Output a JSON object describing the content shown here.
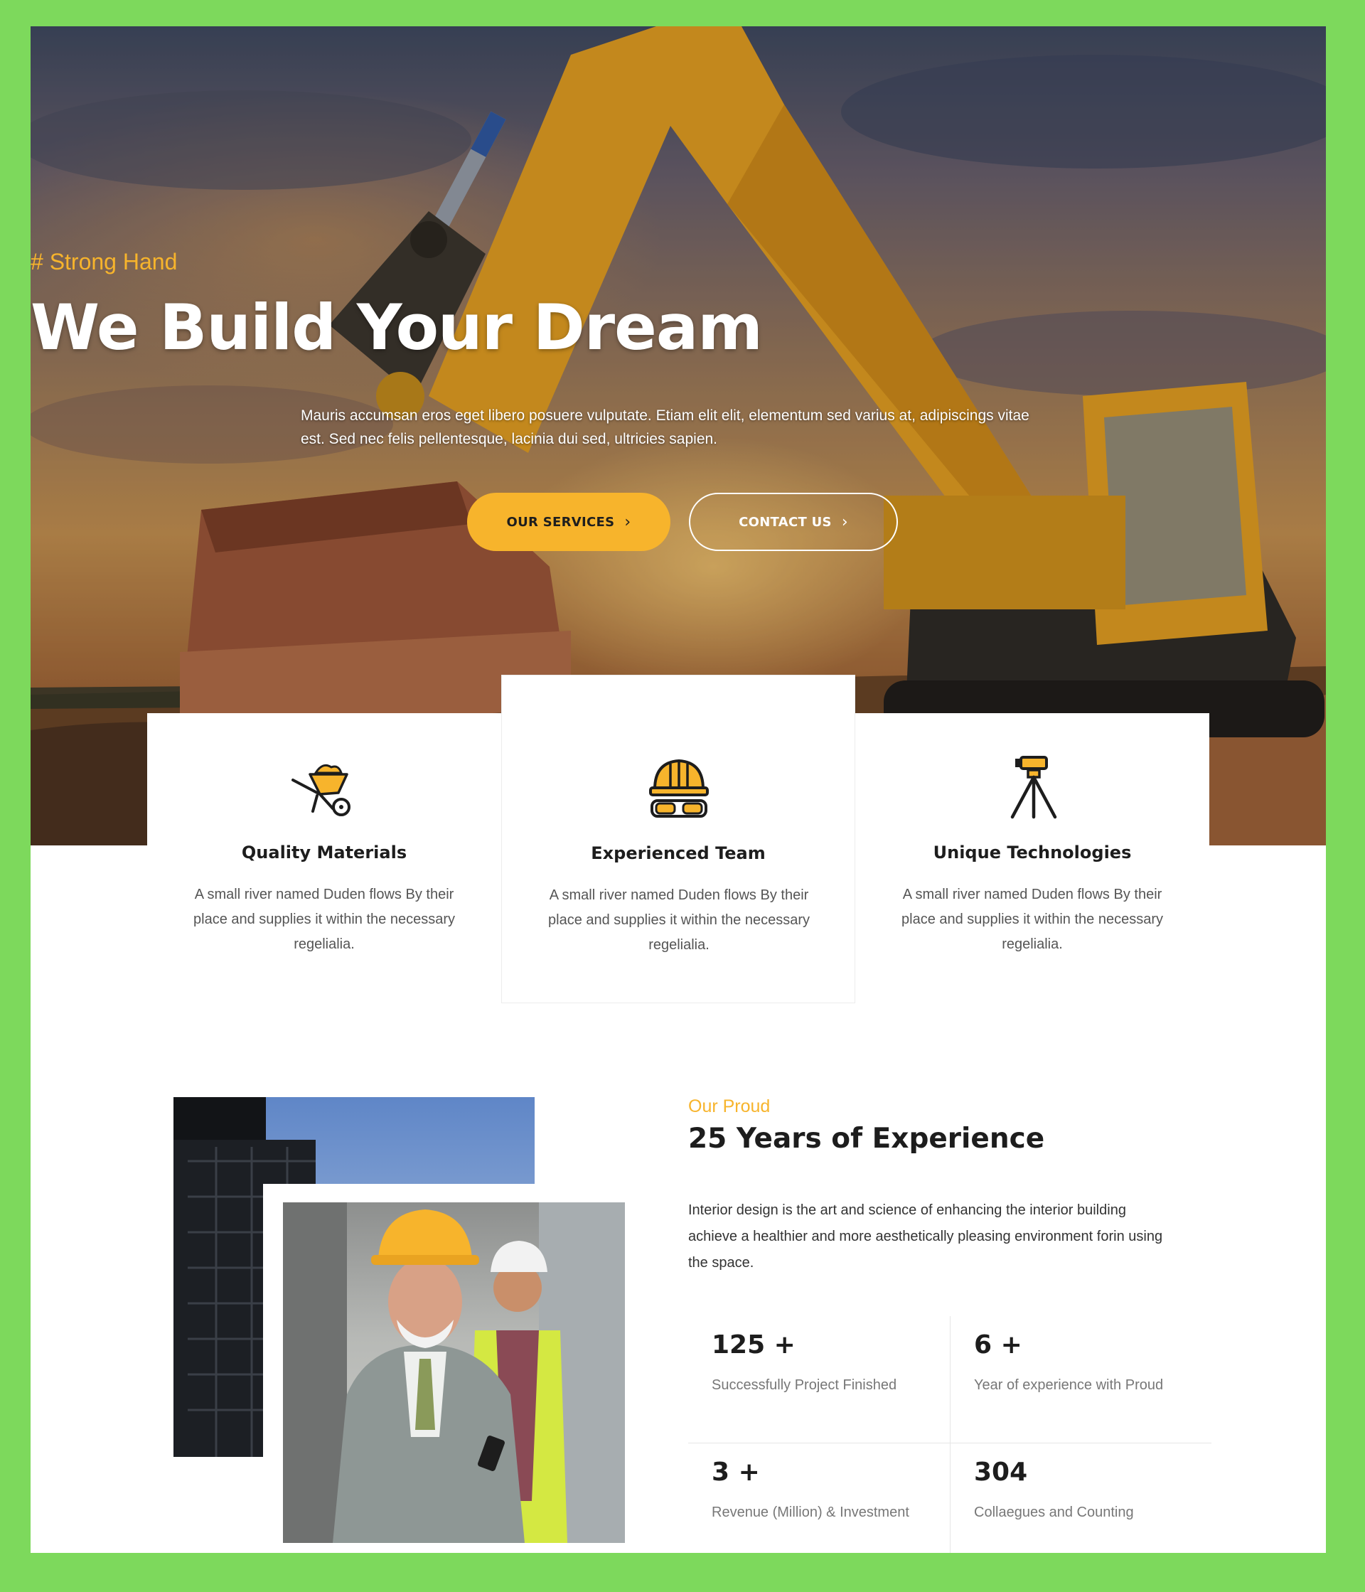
{
  "hero": {
    "tagline": "# Strong Hand",
    "title": "We Build Your Dream",
    "description": "Mauris accumsan eros eget libero posuere vulputate. Etiam elit elit, elementum sed varius at, adipiscings vitae est. Sed nec felis pellentesque, lacinia dui sed, ultricies sapien.",
    "primary_button": "OUR SERVICES",
    "secondary_button": "CONTACT US",
    "chevron": "›"
  },
  "features": [
    {
      "icon": "wheelbarrow-icon",
      "title": "Quality Materials",
      "text": "A small river named Duden flows By their place and supplies it within the necessary regelialia."
    },
    {
      "icon": "hardhat-goggles-icon",
      "title": "Experienced Team",
      "text": "A small river named Duden flows By their place and supplies it within the necessary regelialia."
    },
    {
      "icon": "surveyor-tripod-icon",
      "title": "Unique Technologies",
      "text": "A small river named Duden flows By their place and supplies it within the necessary regelialia."
    }
  ],
  "about": {
    "eyebrow": "Our Proud",
    "title": "25 Years of Experience",
    "description": "Interior design is the art and science of enhancing the interior building achieve a healthier and more aesthetically pleasing environment forin using the space."
  },
  "stats": [
    {
      "value": "125 +",
      "label": "Successfully Project Finished"
    },
    {
      "value": "6 +",
      "label": "Year of experience with Proud"
    },
    {
      "value": "3 +",
      "label": "Revenue (Million) & Investment"
    },
    {
      "value": "304",
      "label": "Collaegues and Counting"
    }
  ],
  "colors": {
    "accent": "#f7b42c",
    "frame": "#7dd95c",
    "heading": "#1d1d1d"
  }
}
